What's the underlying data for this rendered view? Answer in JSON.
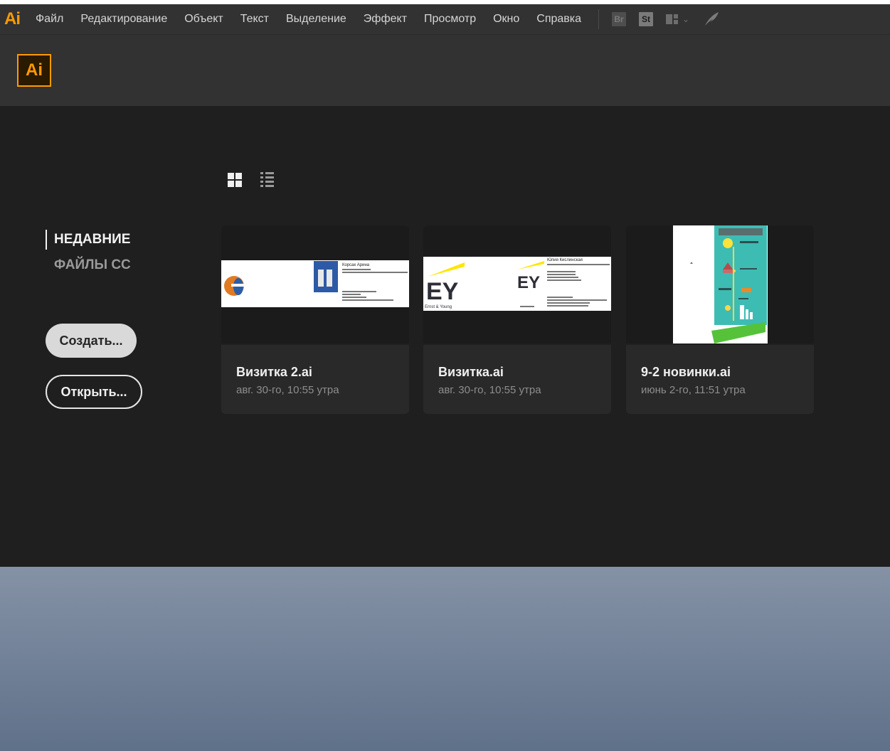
{
  "app": {
    "logo_text": "Ai"
  },
  "menu": {
    "items": [
      "Файл",
      "Редактирование",
      "Объект",
      "Текст",
      "Выделение",
      "Эффект",
      "Просмотр",
      "Окно",
      "Справка"
    ],
    "bridge_label": "Br",
    "stock_label": "St"
  },
  "header": {
    "logo_text": "Ai"
  },
  "nav": {
    "recent": "НЕДАВНИЕ",
    "cc_files": "ФАЙЛЫ CC"
  },
  "buttons": {
    "create": "Создать...",
    "open": "Открыть..."
  },
  "files": [
    {
      "name": "Визитка 2.ai",
      "date": "авг. 30-го, 10:55 утра"
    },
    {
      "name": "Визитка.ai",
      "date": "авг. 30-го, 10:55 утра"
    },
    {
      "name": "9-2 новинки.ai",
      "date": "июнь 2-го, 11:51 утра"
    }
  ],
  "thumb_text": {
    "card1_name": "Корсак Арина",
    "card2_name": "Юлия Кислинская",
    "ey_logo": "EY",
    "ey_tagline": "Ernst & Young"
  },
  "colors": {
    "accent": "#ff9a00",
    "menubar": "#323232",
    "main_bg": "#1f1f1f",
    "card_bg": "#292929"
  }
}
